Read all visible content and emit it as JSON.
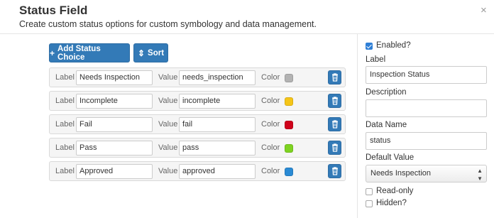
{
  "dialog": {
    "title": "Status Field",
    "subtitle": "Create custom status options for custom symbology and data management.",
    "close_glyph": "×"
  },
  "toolbar": {
    "add_label": "Add Status Choice",
    "add_glyph": "+",
    "sort_label": "Sort",
    "sort_glyph": "⇕"
  },
  "choices": {
    "label_caption": "Label",
    "value_caption": "Value",
    "color_caption": "Color",
    "items": [
      {
        "label": "Needs Inspection",
        "value": "needs_inspection",
        "color": "#b3b3b3"
      },
      {
        "label": "Incomplete",
        "value": "incomplete",
        "color": "#f5c518"
      },
      {
        "label": "Fail",
        "value": "fail",
        "color": "#d0021b"
      },
      {
        "label": "Pass",
        "value": "pass",
        "color": "#7ed321"
      },
      {
        "label": "Approved",
        "value": "approved",
        "color": "#2a8ad4"
      }
    ]
  },
  "sidebar": {
    "enabled_label": "Enabled?",
    "enabled_checked": true,
    "label_heading": "Label",
    "label_value": "Inspection Status",
    "description_heading": "Description",
    "description_value": "",
    "data_name_heading": "Data Name",
    "data_name_value": "status",
    "default_value_heading": "Default Value",
    "default_value": "Needs Inspection",
    "readonly_label": "Read-only",
    "readonly_checked": false,
    "hidden_label": "Hidden?",
    "hidden_checked": false
  },
  "colors": {
    "primary": "#337ab7",
    "checkbox": "#2f7fd6"
  }
}
